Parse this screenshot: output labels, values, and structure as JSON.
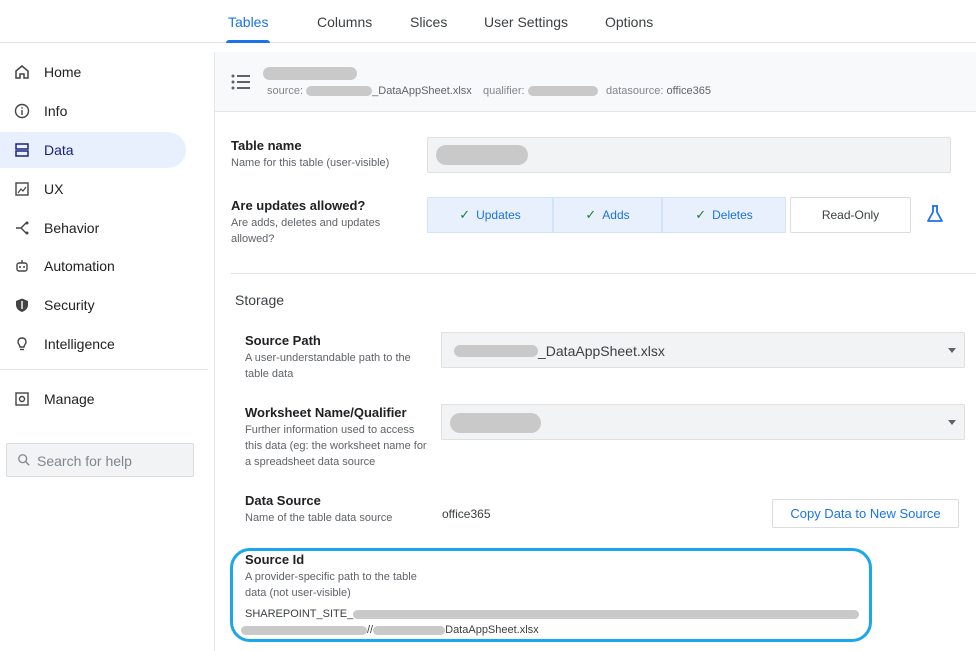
{
  "tabs": [
    {
      "label": "Tables",
      "active": true
    },
    {
      "label": "Columns"
    },
    {
      "label": "Slices"
    },
    {
      "label": "User Settings"
    },
    {
      "label": "Options"
    }
  ],
  "sidebar": {
    "items": [
      {
        "label": "Home",
        "icon": "home-icon"
      },
      {
        "label": "Info",
        "icon": "info-icon"
      },
      {
        "label": "Data",
        "icon": "data-icon",
        "active": true
      },
      {
        "label": "UX",
        "icon": "ux-icon"
      },
      {
        "label": "Behavior",
        "icon": "behavior-icon"
      },
      {
        "label": "Automation",
        "icon": "automation-icon"
      },
      {
        "label": "Security",
        "icon": "security-icon"
      },
      {
        "label": "Intelligence",
        "icon": "intelligence-icon"
      },
      {
        "label": "Manage",
        "icon": "manage-icon"
      }
    ],
    "search_placeholder": "Search for help"
  },
  "table_header": {
    "source_label": "source:",
    "source_value": "_DataAppSheet.xlsx",
    "qualifier_label": "qualifier:",
    "datasource_label": "datasource:",
    "datasource_value": "office365"
  },
  "fields": {
    "table_name": {
      "title": "Table name",
      "desc": "Name for this table (user-visible)"
    },
    "updates": {
      "title": "Are updates allowed?",
      "desc": "Are adds, deletes and updates allowed?",
      "options": [
        "Updates",
        "Adds",
        "Deletes"
      ],
      "readonly_label": "Read-Only"
    },
    "storage_title": "Storage",
    "source_path": {
      "title": "Source Path",
      "desc": "A user-understandable path to the table data",
      "value": "_DataAppSheet.xlsx"
    },
    "worksheet": {
      "title": "Worksheet Name/Qualifier",
      "desc": "Further information used to access this data (eg: the worksheet name for a spreadsheet data source"
    },
    "data_source": {
      "title": "Data Source",
      "desc": "Name of the table data source",
      "value": "office365",
      "copy_button": "Copy Data to New Source"
    },
    "source_id": {
      "title": "Source Id",
      "desc": "A provider-specific path to the table data (not user-visible)",
      "line1": "SHAREPOINT_SITE_",
      "line2_sep": "//",
      "line2_end": "DataAppSheet.xlsx"
    }
  },
  "colors": {
    "accent": "#1a73e8",
    "highlight": "#1aa7ec",
    "check": "#188038"
  }
}
